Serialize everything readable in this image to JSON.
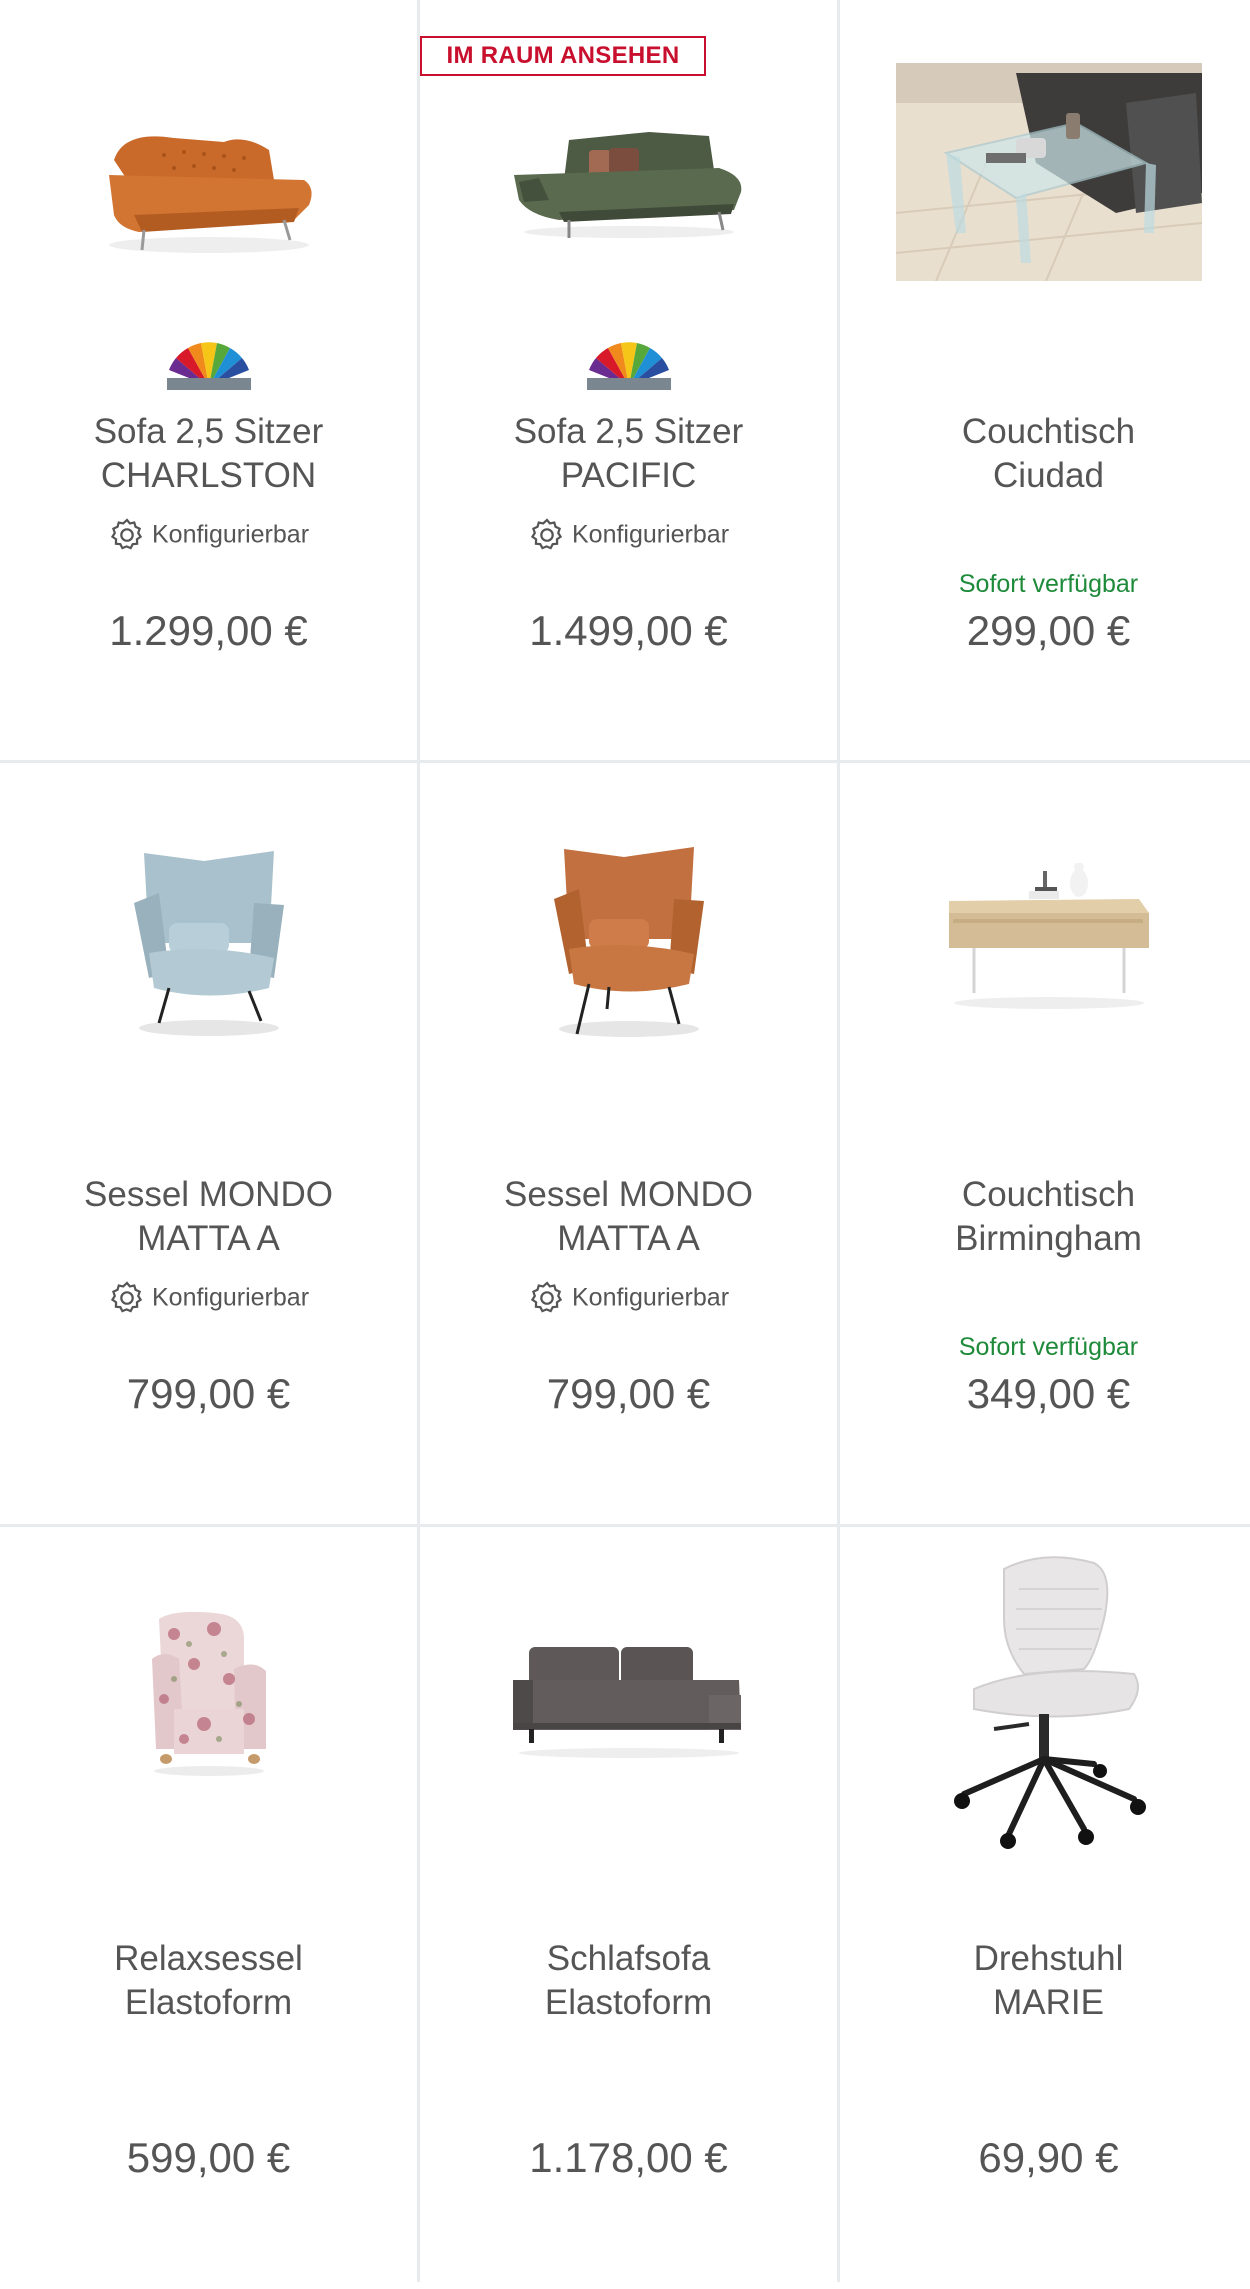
{
  "products": [
    {
      "title_1": "Sofa 2,5 Sitzer",
      "title_2": "CHARLSTON",
      "config": "Konfigurierbar",
      "avail": "",
      "price": "1.299,00 €",
      "badge": ""
    },
    {
      "title_1": "Sofa 2,5 Sitzer",
      "title_2": "PACIFIC",
      "config": "Konfigurierbar",
      "avail": "",
      "price": "1.499,00 €",
      "badge": "IM RAUM ANSEHEN"
    },
    {
      "title_1": "Couchtisch",
      "title_2": "Ciudad",
      "config": "",
      "avail": "Sofort verfügbar",
      "price": "299,00 €",
      "badge": ""
    },
    {
      "title_1": "Sessel MONDO",
      "title_2": "MATTA A",
      "config": "Konfigurierbar",
      "avail": "",
      "price": "799,00 €",
      "badge": ""
    },
    {
      "title_1": "Sessel MONDO",
      "title_2": "MATTA A",
      "config": "Konfigurierbar",
      "avail": "",
      "price": "799,00 €",
      "badge": ""
    },
    {
      "title_1": "Couchtisch",
      "title_2": "Birmingham",
      "config": "",
      "avail": "Sofort verfügbar",
      "price": "349,00 €",
      "badge": ""
    },
    {
      "title_1": "Relaxsessel",
      "title_2": "Elastoform",
      "config": "",
      "avail": "",
      "price": "599,00 €",
      "badge": ""
    },
    {
      "title_1": "Schlafsofa",
      "title_2": "Elastoform",
      "config": "",
      "avail": "",
      "price": "1.178,00 €",
      "badge": ""
    },
    {
      "title_1": "Drehstuhl",
      "title_2": "MARIE",
      "config": "",
      "avail": "",
      "price": "69,90 €",
      "badge": ""
    }
  ],
  "colors": {
    "availability": "#1e8a3a",
    "badge": "#c8102e",
    "text": "#555555",
    "divider": "#e8ebee"
  }
}
